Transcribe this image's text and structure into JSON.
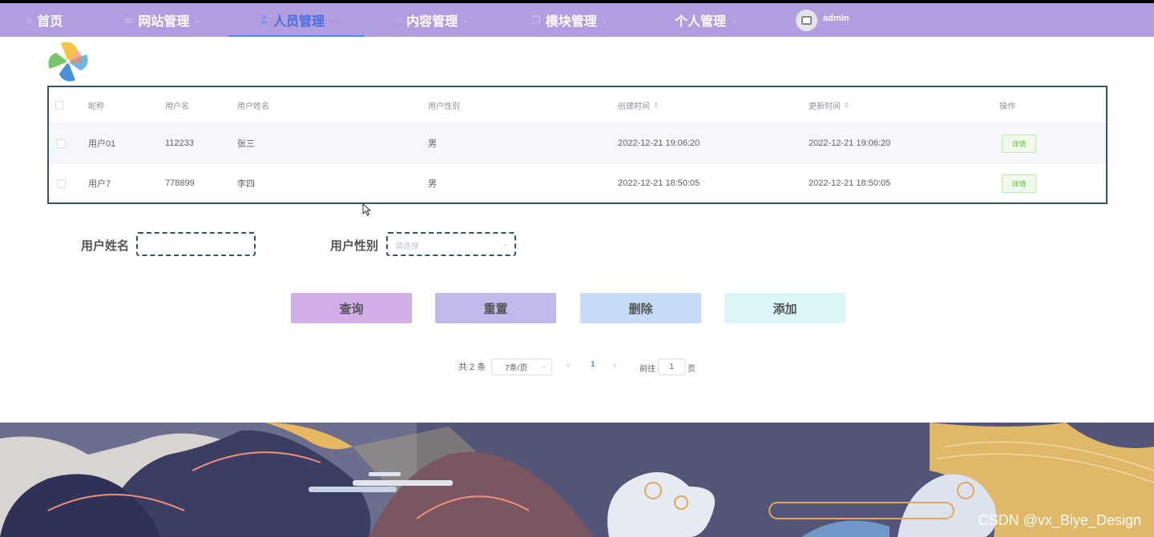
{
  "nav": {
    "items": [
      {
        "label": "首页",
        "icon": "home-icon",
        "glyph": "⌂",
        "has_arrow": false
      },
      {
        "label": "网站管理",
        "icon": "monitor-icon",
        "glyph": "▭",
        "has_arrow": true
      },
      {
        "label": "人员管理",
        "icon": "user-icon",
        "glyph": "👤",
        "has_arrow": true
      },
      {
        "label": "内容管理",
        "icon": "help-circle-icon",
        "glyph": "◌",
        "has_arrow": true
      },
      {
        "label": "模块管理",
        "icon": "copy-icon",
        "glyph": "❐",
        "has_arrow": true
      },
      {
        "label": "个人管理",
        "icon": "",
        "glyph": "",
        "has_arrow": true
      }
    ],
    "arrow_glyph": "⌄",
    "user": "admin"
  },
  "table": {
    "headers": {
      "nickname": "昵称",
      "username": "用户名",
      "realname": "用户姓名",
      "gender": "用户性别",
      "created": "创建时间",
      "updated": "更新时间",
      "action": "操作"
    },
    "sort_glyph": "⇕",
    "rows": [
      {
        "nickname": "用户01",
        "username": "112233",
        "realname": "张三",
        "gender": "男",
        "created": "2022-12-21 19:06:20",
        "updated": "2022-12-21 19:06:20",
        "action": "详情"
      },
      {
        "nickname": "用户7",
        "username": "778899",
        "realname": "李四",
        "gender": "男",
        "created": "2022-12-21 18:50:05",
        "updated": "2022-12-21 18:50:05",
        "action": "详情"
      }
    ]
  },
  "search": {
    "name_label": "用户姓名",
    "name_value": "",
    "gender_label": "用户性别",
    "gender_placeholder": "请选择",
    "select_arrow": "⌄"
  },
  "buttons": {
    "query": "查询",
    "reset": "重置",
    "delete": "删除",
    "add": "添加"
  },
  "pagination": {
    "total": "共 2 条",
    "page_size": "7条/页",
    "prev": "‹",
    "current": "1",
    "next": "›",
    "goto_prefix": "前往",
    "goto_value": "1",
    "goto_suffix": "页"
  },
  "watermark": "CSDN @vx_Biye_Design",
  "colors": {
    "nav_bg": "#b09ee0",
    "btn_query": "#d2aee8",
    "btn_reset": "#c3b8ea",
    "btn_delete": "#c7dbf7",
    "btn_add": "#dcf5f7"
  }
}
